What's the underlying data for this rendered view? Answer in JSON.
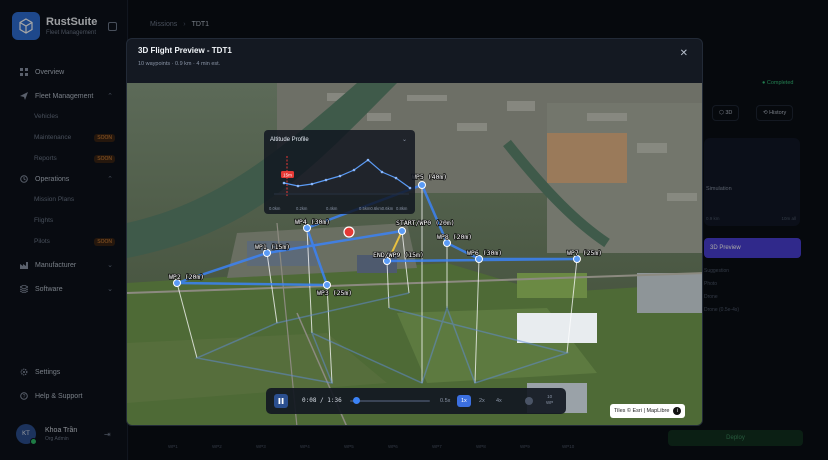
{
  "app": {
    "name": "RustSuite",
    "subtitle": "Fleet Management"
  },
  "breadcrumb": {
    "parent": "Missions",
    "current": "TDT1"
  },
  "nav": {
    "overview": "Overview",
    "fleet": "Fleet Management",
    "vehicles": "Vehicles",
    "maintenance": "Maintenance",
    "reports": "Reports",
    "operations": "Operations",
    "mission_plans": "Mission Plans",
    "flights": "Flights",
    "pilots": "Pilots",
    "manufacturer": "Manufacturer",
    "software": "Software",
    "settings": "Settings",
    "help": "Help & Support",
    "soon": "SOON"
  },
  "user": {
    "name": "Khoa Trần",
    "role": "Org Admin",
    "initials": "KT"
  },
  "right": {
    "status": "Completed",
    "btn_3d": "3D",
    "btn_history": "History",
    "simulation": "Simulation",
    "km": "0.9 km",
    "all": "10m all",
    "preview": "3D Preview",
    "faint1": "Suggestion",
    "faint2": "Photo",
    "faint3": "Drone",
    "faint4": "Drone (0.5e-4s)",
    "deploy": "Deploy"
  },
  "wp_axis": [
    "WP1",
    "WP2",
    "WP3",
    "WP4",
    "WP5",
    "WP6",
    "WP7",
    "WP8",
    "WP9",
    "WP10"
  ],
  "modal": {
    "title": "3D Flight Preview - TDT1",
    "subtitle": "10 waypoints · 0.9 km · 4 min est."
  },
  "altitude": {
    "title": "Altitude Profile",
    "marker": "15m",
    "ticks": [
      "0.0km",
      "0.2km",
      "0.4km",
      "0.5km0.6km0.6km",
      "0.8km"
    ]
  },
  "waypoints": [
    {
      "label": "WP1 (15m)"
    },
    {
      "label": "WP2 (20m)"
    },
    {
      "label": "WP3 (25m)"
    },
    {
      "label": "WP4 (30m)"
    },
    {
      "label": "WP5 (40m)"
    },
    {
      "label": "START/WP0 (20m)"
    },
    {
      "label": "WP8 (20m)"
    },
    {
      "label": "WP6 (30m)"
    },
    {
      "label": "WP7 (25m)"
    },
    {
      "label": "END/WP9 (15m)"
    }
  ],
  "controls": {
    "time": "0:08 / 1:36",
    "progress": 0.08,
    "speeds": [
      "0.5x",
      "1x",
      "2x",
      "4x"
    ],
    "active_speed": "1x",
    "wp_count": "10",
    "wp_unit": "WP"
  },
  "attribution": "Tiles © Esri | MapLibre",
  "colors": {
    "accent": "#3b6fe0",
    "route": "#3b82f6",
    "marker": "#e53935",
    "success": "#35c07a"
  }
}
